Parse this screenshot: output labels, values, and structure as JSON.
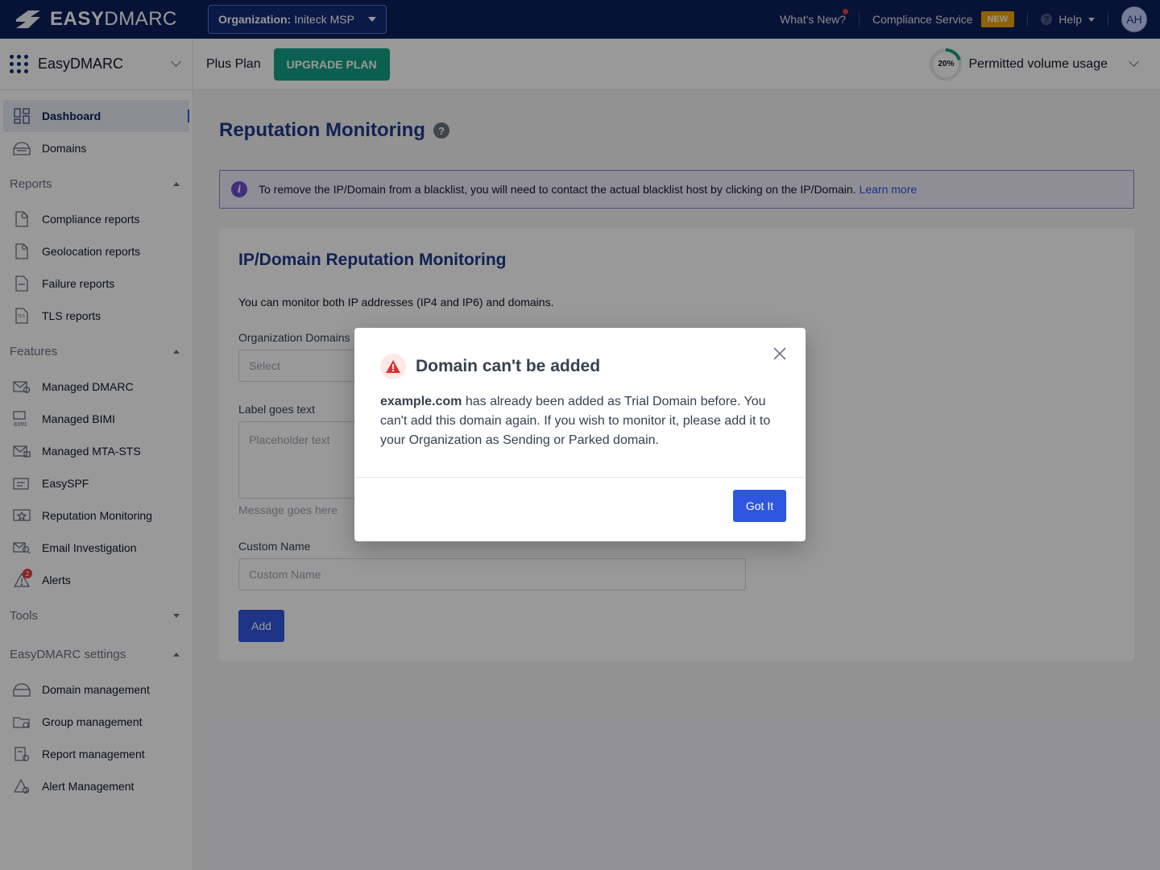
{
  "topbar": {
    "logo_bold": "EASY",
    "logo_light": "DMARC",
    "org_label": "Organization:",
    "org_value": "Initeck MSP",
    "whats_new": "What's New?",
    "compliance": "Compliance Service",
    "new_badge": "NEW",
    "help": "Help",
    "avatar": "AH"
  },
  "subbar": {
    "brand": "EasyDMARC",
    "plan": "Plus Plan",
    "upgrade": "UPGRADE PLAN",
    "volume_percent": "20%",
    "volume_fraction": 0.2,
    "volume_label": "Permitted volume usage"
  },
  "sidebar": {
    "top_items": [
      {
        "label": "Dashboard",
        "icon": "dashboard-icon"
      },
      {
        "label": "Domains",
        "icon": "domains-icon"
      }
    ],
    "reports_title": "Reports",
    "reports": [
      {
        "label": "Compliance reports",
        "icon": "compliance-report-icon"
      },
      {
        "label": "Geolocation reports",
        "icon": "geolocation-report-icon"
      },
      {
        "label": "Failure reports",
        "icon": "failure-report-icon"
      },
      {
        "label": "TLS reports",
        "icon": "tls-report-icon"
      }
    ],
    "features_title": "Features",
    "features": [
      {
        "label": "Managed DMARC",
        "icon": "managed-dmarc-icon"
      },
      {
        "label": "Managed BIMI",
        "icon": "managed-bimi-icon"
      },
      {
        "label": "Managed MTA-STS",
        "icon": "managed-mta-sts-icon"
      },
      {
        "label": "EasySPF",
        "icon": "easyspf-icon"
      },
      {
        "label": "Reputation Monitoring",
        "icon": "reputation-icon"
      },
      {
        "label": "Email Investigation",
        "icon": "email-investigation-icon"
      },
      {
        "label": "Alerts",
        "icon": "alerts-icon",
        "count": "2"
      }
    ],
    "tools_title": "Tools",
    "settings_title": "EasyDMARC settings",
    "settings": [
      {
        "label": "Domain management",
        "icon": "domain-management-icon"
      },
      {
        "label": "Group management",
        "icon": "group-management-icon"
      },
      {
        "label": "Report management",
        "icon": "report-management-icon"
      },
      {
        "label": "Alert Management",
        "icon": "alert-management-icon"
      }
    ]
  },
  "main": {
    "title": "Reputation Monitoring",
    "help_mark": "?",
    "info_text": "To remove the IP/Domain from a blacklist, you will need to contact the actual blacklist host by clicking on the IP/Domain.",
    "info_link": "Learn more",
    "card_title": "IP/Domain Reputation Monitoring",
    "card_desc": "You can monitor both IP addresses (IP4 and IP6) and domains.",
    "org_domains_label": "Organization Domains",
    "org_domains_placeholder": "Select",
    "label_text": "Label goes text",
    "textarea_placeholder": "Placeholder text",
    "message": "Message goes here",
    "custom_name_label": "Custom Name",
    "custom_name_placeholder": "Custom Name",
    "add_button": "Add"
  },
  "modal": {
    "title": "Domain can't be added",
    "domain": "example.com",
    "body": "has already been added as Trial Domain before. You can't add this domain again. If you wish to monitor it, please add it to your Organization as Sending or Parked domain.",
    "button": "Got It"
  },
  "colors": {
    "navy": "#0c1f5c",
    "primary": "#2f56e0",
    "teal": "#14a085",
    "new_badge": "#f0a500",
    "danger": "#e53e3e"
  }
}
